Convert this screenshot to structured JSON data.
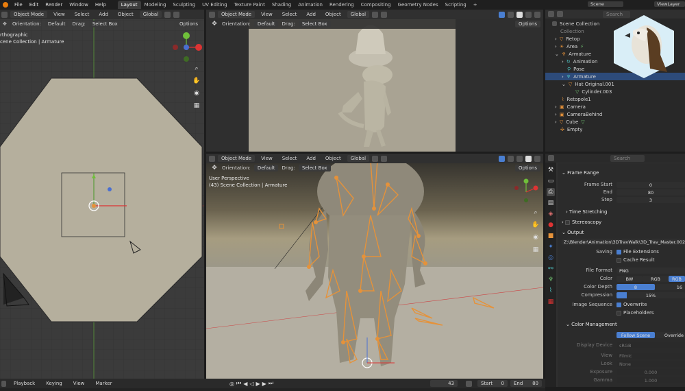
{
  "topbar": {
    "menus": [
      "File",
      "Edit",
      "Render",
      "Window",
      "Help"
    ],
    "workspaces": [
      "Layout",
      "Modeling",
      "Sculpting",
      "UV Editing",
      "Texture Paint",
      "Shading",
      "Animation",
      "Rendering",
      "Compositing",
      "Geometry Nodes",
      "Scripting"
    ],
    "active_workspace": "Layout",
    "add_tab": "+",
    "scene": "Scene",
    "view_layer": "ViewLayer"
  },
  "viewport_common": {
    "mode": "Object Mode",
    "view": "View",
    "select": "Select",
    "add": "Add",
    "object": "Object",
    "transform": "Global",
    "orientation_label": "Orientation:",
    "orientation_value": "Default",
    "drag_label": "Drag:",
    "drag_value": "Select Box",
    "options": "Options"
  },
  "left_viewport": {
    "mode_short": "Object Mode",
    "view_name": "rthographic",
    "collection": "cene Collection | Armature",
    "drag_value": "Select Box",
    "options": "Options"
  },
  "bottom_viewport": {
    "view_name": "User Perspective",
    "collection": "(43) Scene Collection | Armature"
  },
  "outliner": {
    "search_placeholder": "Search",
    "root": "Scene Collection",
    "items": [
      {
        "label": "Collection",
        "dim": true
      },
      {
        "label": "Retop"
      },
      {
        "label": "Area"
      },
      {
        "label": "Armature"
      },
      {
        "label": "Animation"
      },
      {
        "label": "Pose"
      },
      {
        "label": "Armature",
        "selected": true
      },
      {
        "label": "Hat Original.001"
      },
      {
        "label": "Cylinder.003"
      },
      {
        "label": "Retopole1"
      },
      {
        "label": "Camera"
      },
      {
        "label": "CameraBehind"
      },
      {
        "label": "Cube"
      },
      {
        "label": "Empty"
      }
    ]
  },
  "properties": {
    "search_placeholder": "Search",
    "frame_range": {
      "title": "Frame Range",
      "start_label": "Frame Start",
      "start": "0",
      "end_label": "End",
      "end": "80",
      "step_label": "Step",
      "step": "3"
    },
    "time_stretching": "Time Stretching",
    "stereoscopy": "Stereoscopy",
    "output": {
      "title": "Output",
      "path": "Z:\\Blender\\Animation\\3DTravWalk\\3D_Trav_Master.002\\Idle\\",
      "saving_label": "Saving",
      "file_extensions": "File Extensions",
      "cache_result": "Cache Result",
      "file_format_label": "File Format",
      "file_format": "PNG",
      "color_label": "Color",
      "color_options": [
        "BW",
        "RGB",
        "RGB"
      ],
      "color_depth_label": "Color Depth",
      "color_depth_options": [
        "8",
        "16"
      ],
      "compression_label": "Compression",
      "compression": "15%",
      "compression_value": 0.15,
      "image_sequence_label": "Image Sequence",
      "overwrite": "Overwrite",
      "placeholders": "Placeholders"
    },
    "color_management": {
      "title": "Color Management",
      "options": [
        "Follow Scene",
        "Override"
      ],
      "display_device_label": "Display Device",
      "display_device": "sRGB",
      "view_label": "View",
      "view": "Filmic",
      "look_label": "Look",
      "look": "None",
      "exposure_label": "Exposure",
      "exposure": "0.000",
      "gamma_label": "Gamma",
      "gamma": "1.000"
    }
  },
  "timeline": {
    "playback": "Playback",
    "keying": "Keying",
    "view": "View",
    "marker": "Marker",
    "current_frame": "43",
    "start_label": "Start",
    "start": "0",
    "end_label": "End",
    "end": "80"
  },
  "colors": {
    "accent": "#4a7fd1",
    "bone": "#e5923a",
    "selected_row": "#2d4b7a"
  }
}
